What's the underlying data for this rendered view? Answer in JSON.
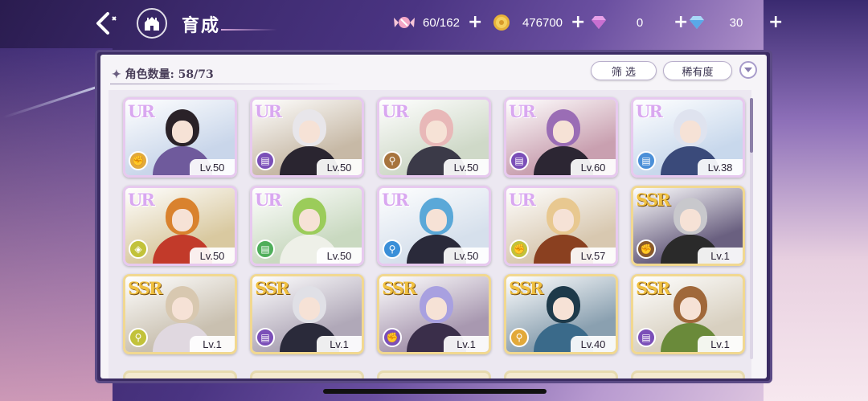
{
  "header": {
    "title": "育成"
  },
  "resources": [
    {
      "icon": "candy-icon",
      "value": "60/162"
    },
    {
      "icon": "gold-coin-icon",
      "value": "476700"
    },
    {
      "icon": "pink-diamond-icon",
      "value": "0"
    },
    {
      "icon": "blue-diamond-icon",
      "value": "30"
    }
  ],
  "panel": {
    "count_label": "角色数量: 58/73",
    "filter_label": "筛 选",
    "rarity_label": "稀有度"
  },
  "colors": {
    "ur_border": "#e7c9ef",
    "ssr_border": "#f1d890"
  },
  "cards": [
    {
      "rarity": "UR",
      "level": "Lv.50",
      "class_icon": "fist-icon",
      "badge": "#e2a93a",
      "hair": "#2a2228",
      "outfit": "#6f5a9c",
      "bg": "#c9d6ea"
    },
    {
      "rarity": "UR",
      "level": "Lv.50",
      "class_icon": "book-icon",
      "badge": "#7b4fb8",
      "hair": "#e8e6ea",
      "outfit": "#2a2530",
      "bg": "#c7b9a6"
    },
    {
      "rarity": "UR",
      "level": "Lv.50",
      "class_icon": "wand-icon",
      "badge": "#a7743e",
      "hair": "#e8b8b8",
      "outfit": "#3b3a48",
      "bg": "#cfd9c8"
    },
    {
      "rarity": "UR",
      "level": "Lv.60",
      "class_icon": "book-icon",
      "badge": "#7b4fb8",
      "hair": "#9a6db5",
      "outfit": "#2c2633",
      "bg": "#c9a0b0"
    },
    {
      "rarity": "UR",
      "level": "Lv.38",
      "class_icon": "book-icon",
      "badge": "#4a8fd8",
      "hair": "#dfe3ef",
      "outfit": "#3a4a7a",
      "bg": "#c8d8ec"
    },
    {
      "rarity": "UR",
      "level": "Lv.50",
      "class_icon": "shield-icon",
      "badge": "#c2c23a",
      "hair": "#d9822e",
      "outfit": "#c23a2a",
      "bg": "#d9c9a0"
    },
    {
      "rarity": "UR",
      "level": "Lv.50",
      "class_icon": "book-icon",
      "badge": "#4fae5a",
      "hair": "#9bcc5a",
      "outfit": "#eef0e8",
      "bg": "#c9d9c0"
    },
    {
      "rarity": "UR",
      "level": "Lv.50",
      "class_icon": "wand-icon",
      "badge": "#3a8fd8",
      "hair": "#5aa8d8",
      "outfit": "#2a2a3a",
      "bg": "#d6e0ec"
    },
    {
      "rarity": "UR",
      "level": "Lv.57",
      "class_icon": "fist-icon",
      "badge": "#c2c23a",
      "hair": "#e8c890",
      "outfit": "#8a4020",
      "bg": "#d8c8b0"
    },
    {
      "rarity": "SSR",
      "level": "Lv.1",
      "class_icon": "fist-icon",
      "badge": "#8a5a2a",
      "hair": "#c8c8cc",
      "outfit": "#2a2a2a",
      "bg": "#6a6080"
    },
    {
      "rarity": "SSR",
      "level": "Lv.1",
      "class_icon": "wand-icon",
      "badge": "#c2c23a",
      "hair": "#d8c8b0",
      "outfit": "#e0d8e0",
      "bg": "#c9c0b0"
    },
    {
      "rarity": "SSR",
      "level": "Lv.1",
      "class_icon": "book-icon",
      "badge": "#7b4fb8",
      "hair": "#e0e0e6",
      "outfit": "#2a2a3a",
      "bg": "#b0a8b8"
    },
    {
      "rarity": "SSR",
      "level": "Lv.1",
      "class_icon": "fist-icon",
      "badge": "#7b4fb8",
      "hair": "#a8a0e0",
      "outfit": "#3a2e4a",
      "bg": "#a898b0"
    },
    {
      "rarity": "SSR",
      "level": "Lv.40",
      "class_icon": "wand-icon",
      "badge": "#e2a93a",
      "hair": "#1e3a4a",
      "outfit": "#3a6a8a",
      "bg": "#8aa0b0"
    },
    {
      "rarity": "SSR",
      "level": "Lv.1",
      "class_icon": "book-icon",
      "badge": "#7b4fb8",
      "hair": "#a0683a",
      "outfit": "#6a8a3a",
      "bg": "#d8d0c0"
    }
  ]
}
